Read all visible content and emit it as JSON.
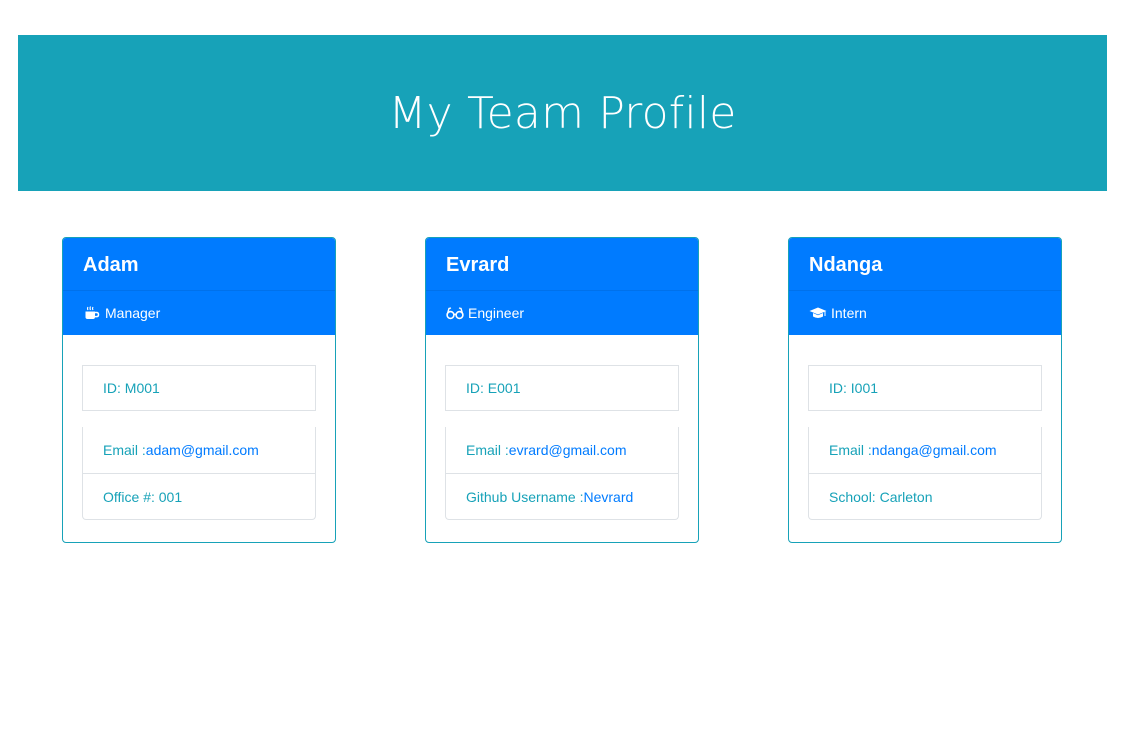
{
  "header": {
    "title": "My Team Profile"
  },
  "cards": [
    {
      "name": "Adam",
      "role": "Manager",
      "role_icon": "mug-hot-icon",
      "id": "ID: M001",
      "email_label": "Email : ",
      "email": "adam@gmail.com",
      "extra_label": "Office #: 001",
      "extra_value": ""
    },
    {
      "name": "Evrard",
      "role": "Engineer",
      "role_icon": "glasses-icon",
      "id": "ID: E001",
      "email_label": "Email : ",
      "email": "evrard@gmail.com",
      "extra_label": "Github Username : ",
      "extra_value": "Nevrard"
    },
    {
      "name": "Ndanga",
      "role": "Intern",
      "role_icon": "graduation-cap-icon",
      "id": "ID: I001",
      "email_label": "Email : ",
      "email": "ndanga@gmail.com",
      "extra_label": "School: Carleton",
      "extra_value": ""
    }
  ],
  "colors": {
    "jumbotron": "#17a2b8",
    "card_header": "#007bff",
    "text_info": "#17a2b8",
    "link": "#007bff"
  }
}
